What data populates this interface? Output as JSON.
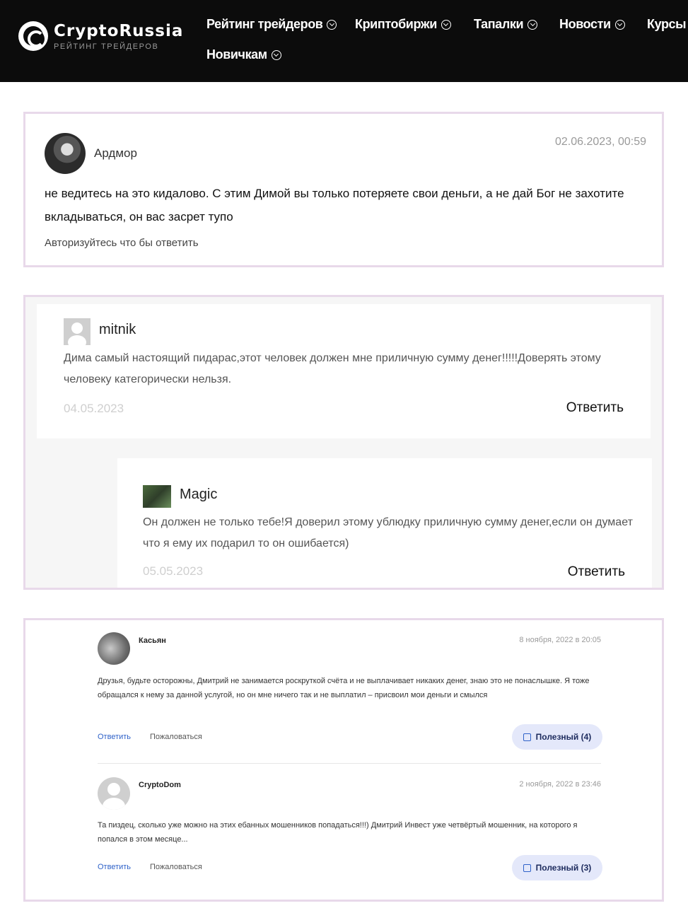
{
  "header": {
    "logo_title": "CryptoRussia",
    "logo_subtitle": "РЕЙТИНГ ТРЕЙДЕРОВ",
    "nav": [
      "Рейтинг трейдеров",
      "Криптобиржи",
      "Тапалки",
      "Новости",
      "Курсы",
      "Новичкам"
    ]
  },
  "comment1": {
    "author": "Ардмор",
    "date": "02.06.2023, 00:59",
    "text": "не ведитесь на это кидалово. С этим Димой вы только потеряете свои деньги, а не дай Бог не захотите вкладываться, он вас засрет тупо",
    "auth_hint": "Авторизуйтесь что бы ответить"
  },
  "comment2": {
    "author": "mitnik",
    "text": "Дима самый настоящий пидарас,этот человек должен мне приличную сумму денег!!!!!Доверять этому человеку категорически нельзя.",
    "date": "04.05.2023",
    "reply": "Ответить",
    "sub": {
      "author": "Magic",
      "text": "Он должен не только тебе!Я доверил этому ублюдку приличную сумму денег,если он думает что я ему их подарил то он ошибается)",
      "date": "05.05.2023",
      "reply": "Ответить"
    }
  },
  "comment3": {
    "items": [
      {
        "author": "Касьян",
        "date": "8 ноября, 2022 в 20:05",
        "text": "Друзья, будьте осторожны, Дмитрий не занимается роскруткой счёта и не выплачивает никаких денег, знаю это не понаслышке. Я тоже обращался к нему за данной услугой, но он мне ничего так и не выплатил – присвоил мои деньги и смылся",
        "reply": "Ответить",
        "report": "Пожаловаться",
        "useful": "Полезный (4)"
      },
      {
        "author": "CryptoDom",
        "date": "2 ноября, 2022 в 23:46",
        "text": "Та пиздец, сколько уже можно на этих ебанных мошенников попадаться!!!) Дмитрий Инвест уже четвёртый мошенник, на которого я попался в этом месяце...",
        "reply": "Ответить",
        "report": "Пожаловаться",
        "useful": "Полезный (3)"
      }
    ]
  }
}
